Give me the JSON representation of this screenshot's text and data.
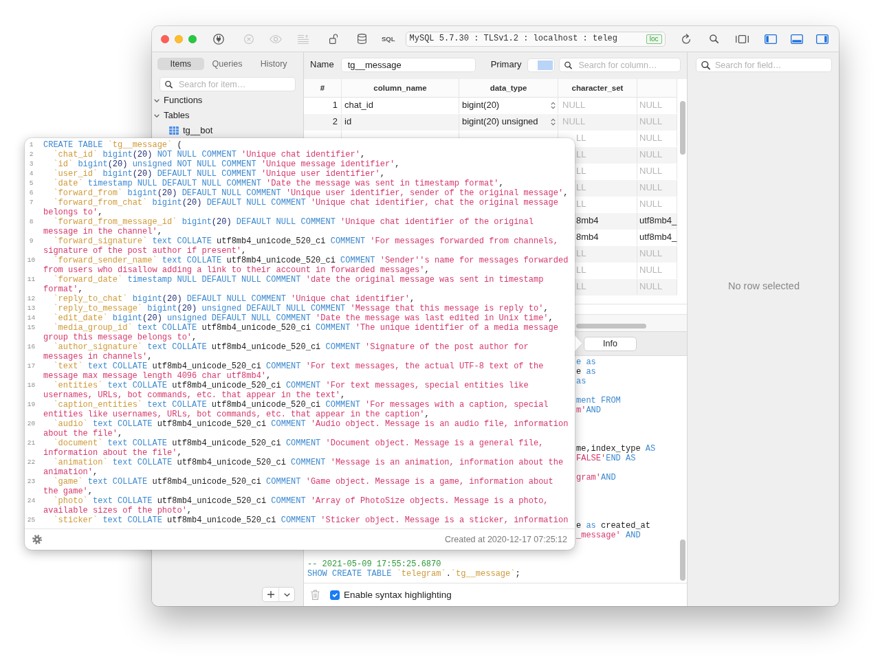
{
  "toolbar": {
    "buttons": [
      {
        "disabled": false
      },
      {
        "disabled": true
      },
      {
        "disabled": true
      },
      {
        "disabled": true
      },
      {
        "disabled": false
      },
      {
        "disabled": false
      }
    ],
    "sql_button": "SQL",
    "connection": "MySQL 5.7.30 : TLSv1.2 : localhost : teleg",
    "connection_tag": "loc",
    "panel_toggles": [
      {
        "on": true
      },
      {
        "on": true
      },
      {
        "on": true
      }
    ]
  },
  "sidebar": {
    "tabs": [
      {
        "label": "Items",
        "selected": true
      },
      {
        "label": "Queries",
        "selected": false
      },
      {
        "label": "History",
        "selected": false
      }
    ],
    "search": {
      "placeholder": "Search for item…"
    },
    "tree": [
      {
        "label": "Functions",
        "expanded": true
      },
      {
        "label": "Tables",
        "expanded": true,
        "children": [
          {
            "label": "tg__bot"
          }
        ]
      }
    ]
  },
  "structure": {
    "name_label": "Name",
    "name": "tg__message",
    "primary_label": "Primary",
    "column_search": {
      "placeholder": "Search for column…"
    },
    "table": {
      "columns": [
        "#",
        "column_name",
        "data_type",
        "character_set"
      ],
      "rows": [
        {
          "number": "1",
          "column_name": "chat_id",
          "data_type": "bigint(20)",
          "character_set": {
            "text": "NULL",
            "null": true
          },
          "column_5": {
            "text": "NULL",
            "null": true
          }
        },
        {
          "number": "2",
          "column_name": "id",
          "data_type": "bigint(20) unsigned",
          "character_set": {
            "text": "NULL",
            "null": true
          },
          "column_5": {
            "text": "NULL",
            "null": true
          }
        },
        {
          "character_set": {
            "text": "LL",
            "null": true
          },
          "column_5": {
            "text": "NULL",
            "null": true
          }
        },
        {
          "character_set": {
            "text": "LL",
            "null": true
          },
          "column_5": {
            "text": "NULL",
            "null": true
          }
        },
        {
          "character_set": {
            "text": "LL",
            "null": true
          },
          "column_5": {
            "text": "NULL",
            "null": true
          }
        },
        {
          "character_set": {
            "text": "LL",
            "null": true
          },
          "column_5": {
            "text": "NULL",
            "null": true
          }
        },
        {
          "character_set": {
            "text": "LL",
            "null": true
          },
          "column_5": {
            "text": "NULL",
            "null": true
          }
        },
        {
          "character_set": {
            "text": "8mb4",
            "null": false
          },
          "column_5": {
            "text": "utf8mb4_",
            "null": false
          }
        },
        {
          "character_set": {
            "text": "8mb4",
            "null": false
          },
          "column_5": {
            "text": "utf8mb4_",
            "null": false
          }
        },
        {
          "character_set": {
            "text": "LL",
            "null": true
          },
          "column_5": {
            "text": "NULL",
            "null": true
          }
        },
        {
          "character_set": {
            "text": "LL",
            "null": true
          },
          "column_5": {
            "text": "NULL",
            "null": true
          }
        },
        {
          "character_set": {
            "text": "LL",
            "null": true
          },
          "column_5": {
            "text": "NULL",
            "null": true
          }
        }
      ]
    },
    "tabs": [
      {
        "label": "Info",
        "selected": true
      }
    ],
    "console": {
      "covered_lines": [
        {
          "tokens": [
            {
              "kind": "keyword",
              "text": "e as"
            }
          ]
        },
        {
          "tokens": [
            {
              "kind": "plain",
              "text": "e"
            },
            {
              "kind": "keyword",
              "text": " as"
            }
          ]
        },
        {
          "tokens": [
            {
              "kind": "keyword",
              "text": "as"
            }
          ]
        },
        {
          "tokens": [
            {
              "kind": "keyword",
              "text": "ment FROM"
            }
          ]
        },
        {
          "tokens": [
            {
              "kind": "string",
              "text": "m'"
            },
            {
              "kind": "keyword",
              "text": "AND"
            }
          ]
        },
        {
          "tokens": [
            {
              "kind": "plain",
              "text": "me,index_type"
            },
            {
              "kind": "keyword",
              "text": " AS"
            }
          ]
        },
        {
          "tokens": [
            {
              "kind": "string",
              "text": "FALSE'"
            },
            {
              "kind": "keyword",
              "text": "END AS"
            }
          ]
        },
        {
          "tokens": [
            {
              "kind": "string",
              "text": "gram'"
            },
            {
              "kind": "keyword",
              "text": "AND"
            }
          ]
        },
        {
          "tokens": [
            {
              "kind": "plain",
              "text": "e "
            },
            {
              "kind": "keyword",
              "text": "as"
            },
            {
              "kind": "plain",
              "text": " created_at"
            }
          ]
        },
        {
          "tokens": [
            {
              "kind": "string",
              "text": "_message'"
            },
            {
              "kind": "keyword",
              "text": " AND"
            }
          ]
        }
      ],
      "lines": [
        {
          "tokens": [
            {
              "kind": "comment",
              "text": "-- 2021-05-09 17:55:25.6870"
            }
          ]
        },
        {
          "tokens": [
            {
              "kind": "keyword",
              "text": "SHOW CREATE TABLE "
            },
            {
              "kind": "identifier",
              "text": "`telegram`"
            },
            {
              "kind": "plain",
              "text": "."
            },
            {
              "kind": "identifier",
              "text": "`tg__message`"
            },
            {
              "kind": "plain",
              "text": ";"
            }
          ]
        }
      ]
    },
    "syntax_highlighting": {
      "label": "Enable syntax highlighting",
      "checked": true
    }
  },
  "details": {
    "search": {
      "placeholder": "Search for field…"
    },
    "empty_message": "No row selected"
  },
  "create_table_popover": {
    "lines": [
      {
        "number": "1",
        "tokens": [
          {
            "kind": "keyword",
            "text": "CREATE TABLE "
          },
          {
            "kind": "identifier",
            "text": "`tg__message`"
          },
          {
            "kind": "plain",
            "text": " ("
          }
        ]
      },
      {
        "number": "2",
        "tokens": [
          {
            "kind": "identifier",
            "text": "  `chat_id`"
          },
          {
            "kind": "keyword",
            "text": " bigint"
          },
          {
            "kind": "number",
            "text": "(20)"
          },
          {
            "kind": "keyword",
            "text": " NOT NULL COMMENT "
          },
          {
            "kind": "string",
            "text": "'Unique chat identifier'"
          },
          {
            "kind": "plain",
            "text": ","
          }
        ]
      },
      {
        "number": "3",
        "tokens": [
          {
            "kind": "identifier",
            "text": "  `id`"
          },
          {
            "kind": "keyword",
            "text": " bigint"
          },
          {
            "kind": "number",
            "text": "(20)"
          },
          {
            "kind": "keyword",
            "text": " unsigned NOT NULL COMMENT "
          },
          {
            "kind": "string",
            "text": "'Unique message identifier'"
          },
          {
            "kind": "plain",
            "text": ","
          }
        ]
      },
      {
        "number": "4",
        "tokens": [
          {
            "kind": "identifier",
            "text": "  `user_id`"
          },
          {
            "kind": "keyword",
            "text": " bigint"
          },
          {
            "kind": "number",
            "text": "(20)"
          },
          {
            "kind": "keyword",
            "text": " DEFAULT NULL COMMENT "
          },
          {
            "kind": "string",
            "text": "'Unique user identifier'"
          },
          {
            "kind": "plain",
            "text": ","
          }
        ]
      },
      {
        "number": "5",
        "tokens": [
          {
            "kind": "identifier",
            "text": "  `date`"
          },
          {
            "kind": "keyword",
            "text": " timestamp NULL DEFAULT NULL COMMENT "
          },
          {
            "kind": "string",
            "text": "'Date the message was sent in timestamp format'"
          },
          {
            "kind": "plain",
            "text": ","
          }
        ]
      },
      {
        "number": "6",
        "tokens": [
          {
            "kind": "identifier",
            "text": "  `forward_from`"
          },
          {
            "kind": "keyword",
            "text": " bigint"
          },
          {
            "kind": "number",
            "text": "(20)"
          },
          {
            "kind": "keyword",
            "text": " DEFAULT NULL COMMENT "
          },
          {
            "kind": "string",
            "text": "'Unique user identifier, sender of the original message'"
          },
          {
            "kind": "plain",
            "text": ","
          }
        ]
      },
      {
        "number": "7",
        "tokens": [
          {
            "kind": "identifier",
            "text": "  `forward_from_chat`"
          },
          {
            "kind": "keyword",
            "text": " bigint"
          },
          {
            "kind": "number",
            "text": "(20)"
          },
          {
            "kind": "keyword",
            "text": " DEFAULT NULL COMMENT "
          },
          {
            "kind": "string",
            "text": "'Unique chat identifier, chat the original message belongs to'"
          },
          {
            "kind": "plain",
            "text": ","
          }
        ]
      },
      {
        "number": "8",
        "tokens": [
          {
            "kind": "identifier",
            "text": "  `forward_from_message_id`"
          },
          {
            "kind": "keyword",
            "text": " bigint"
          },
          {
            "kind": "number",
            "text": "(20)"
          },
          {
            "kind": "keyword",
            "text": " DEFAULT NULL COMMENT "
          },
          {
            "kind": "string",
            "text": "'Unique chat identifier of the original message in the channel'"
          },
          {
            "kind": "plain",
            "text": ","
          }
        ]
      },
      {
        "number": "9",
        "tokens": [
          {
            "kind": "identifier",
            "text": "  `forward_signature`"
          },
          {
            "kind": "keyword",
            "text": " text COLLATE "
          },
          {
            "kind": "plain",
            "text": "utf8mb4_unicode_520_ci"
          },
          {
            "kind": "keyword",
            "text": " COMMENT "
          },
          {
            "kind": "string",
            "text": "'For messages forwarded from channels, signature of the post author if present'"
          },
          {
            "kind": "plain",
            "text": ","
          }
        ]
      },
      {
        "number": "10",
        "tokens": [
          {
            "kind": "identifier",
            "text": "  `forward_sender_name`"
          },
          {
            "kind": "keyword",
            "text": " text COLLATE "
          },
          {
            "kind": "plain",
            "text": "utf8mb4_unicode_520_ci"
          },
          {
            "kind": "keyword",
            "text": " COMMENT "
          },
          {
            "kind": "string",
            "text": "'Sender''s name for messages forwarded from users who disallow adding a link to their account in forwarded messages'"
          },
          {
            "kind": "plain",
            "text": ","
          }
        ]
      },
      {
        "number": "11",
        "tokens": [
          {
            "kind": "identifier",
            "text": "  `forward_date`"
          },
          {
            "kind": "keyword",
            "text": " timestamp NULL DEFAULT NULL COMMENT "
          },
          {
            "kind": "string",
            "text": "'date the original message was sent in timestamp format'"
          },
          {
            "kind": "plain",
            "text": ","
          }
        ]
      },
      {
        "number": "12",
        "tokens": [
          {
            "kind": "identifier",
            "text": "  `reply_to_chat`"
          },
          {
            "kind": "keyword",
            "text": " bigint"
          },
          {
            "kind": "number",
            "text": "(20)"
          },
          {
            "kind": "keyword",
            "text": " DEFAULT NULL COMMENT "
          },
          {
            "kind": "string",
            "text": "'Unique chat identifier'"
          },
          {
            "kind": "plain",
            "text": ","
          }
        ]
      },
      {
        "number": "13",
        "tokens": [
          {
            "kind": "identifier",
            "text": "  `reply_to_message`"
          },
          {
            "kind": "keyword",
            "text": " bigint"
          },
          {
            "kind": "number",
            "text": "(20)"
          },
          {
            "kind": "keyword",
            "text": " unsigned DEFAULT NULL COMMENT "
          },
          {
            "kind": "string",
            "text": "'Message that this message is reply to'"
          },
          {
            "kind": "plain",
            "text": ","
          }
        ]
      },
      {
        "number": "14",
        "tokens": [
          {
            "kind": "identifier",
            "text": "  `edit_date`"
          },
          {
            "kind": "keyword",
            "text": " bigint"
          },
          {
            "kind": "number",
            "text": "(20)"
          },
          {
            "kind": "keyword",
            "text": " unsigned DEFAULT NULL COMMENT "
          },
          {
            "kind": "string",
            "text": "'Date the message was last edited in Unix time'"
          },
          {
            "kind": "plain",
            "text": ","
          }
        ]
      },
      {
        "number": "15",
        "tokens": [
          {
            "kind": "identifier",
            "text": "  `media_group_id`"
          },
          {
            "kind": "keyword",
            "text": " text COLLATE "
          },
          {
            "kind": "plain",
            "text": "utf8mb4_unicode_520_ci"
          },
          {
            "kind": "keyword",
            "text": " COMMENT "
          },
          {
            "kind": "string",
            "text": "'The unique identifier of a media message group this message belongs to'"
          },
          {
            "kind": "plain",
            "text": ","
          }
        ]
      },
      {
        "number": "16",
        "tokens": [
          {
            "kind": "identifier",
            "text": "  `author_signature`"
          },
          {
            "kind": "keyword",
            "text": " text COLLATE "
          },
          {
            "kind": "plain",
            "text": "utf8mb4_unicode_520_ci"
          },
          {
            "kind": "keyword",
            "text": " COMMENT "
          },
          {
            "kind": "string",
            "text": "'Signature of the post author for messages in channels'"
          },
          {
            "kind": "plain",
            "text": ","
          }
        ]
      },
      {
        "number": "17",
        "tokens": [
          {
            "kind": "identifier",
            "text": "  `text`"
          },
          {
            "kind": "keyword",
            "text": " text COLLATE "
          },
          {
            "kind": "plain",
            "text": "utf8mb4_unicode_520_ci"
          },
          {
            "kind": "keyword",
            "text": " COMMENT "
          },
          {
            "kind": "string",
            "text": "'For text messages, the actual UTF-8 text of the message max message length 4096 char utf8mb4'"
          },
          {
            "kind": "plain",
            "text": ","
          }
        ]
      },
      {
        "number": "18",
        "tokens": [
          {
            "kind": "identifier",
            "text": "  `entities`"
          },
          {
            "kind": "keyword",
            "text": " text COLLATE "
          },
          {
            "kind": "plain",
            "text": "utf8mb4_unicode_520_ci"
          },
          {
            "kind": "keyword",
            "text": " COMMENT "
          },
          {
            "kind": "string",
            "text": "'For text messages, special entities like usernames, URLs, bot commands, etc. that appear in the text'"
          },
          {
            "kind": "plain",
            "text": ","
          }
        ]
      },
      {
        "number": "19",
        "tokens": [
          {
            "kind": "identifier",
            "text": "  `caption_entities`"
          },
          {
            "kind": "keyword",
            "text": " text COLLATE "
          },
          {
            "kind": "plain",
            "text": "utf8mb4_unicode_520_ci"
          },
          {
            "kind": "keyword",
            "text": " COMMENT "
          },
          {
            "kind": "string",
            "text": "'For messages with a caption, special entities like usernames, URLs, bot commands, etc. that appear in the caption'"
          },
          {
            "kind": "plain",
            "text": ","
          }
        ]
      },
      {
        "number": "20",
        "tokens": [
          {
            "kind": "identifier",
            "text": "  `audio`"
          },
          {
            "kind": "keyword",
            "text": " text COLLATE "
          },
          {
            "kind": "plain",
            "text": "utf8mb4_unicode_520_ci"
          },
          {
            "kind": "keyword",
            "text": " COMMENT "
          },
          {
            "kind": "string",
            "text": "'Audio object. Message is an audio file, information about the file'"
          },
          {
            "kind": "plain",
            "text": ","
          }
        ]
      },
      {
        "number": "21",
        "tokens": [
          {
            "kind": "identifier",
            "text": "  `document`"
          },
          {
            "kind": "keyword",
            "text": " text COLLATE "
          },
          {
            "kind": "plain",
            "text": "utf8mb4_unicode_520_ci"
          },
          {
            "kind": "keyword",
            "text": " COMMENT "
          },
          {
            "kind": "string",
            "text": "'Document object. Message is a general file, information about the file'"
          },
          {
            "kind": "plain",
            "text": ","
          }
        ]
      },
      {
        "number": "22",
        "tokens": [
          {
            "kind": "identifier",
            "text": "  `animation`"
          },
          {
            "kind": "keyword",
            "text": " text COLLATE "
          },
          {
            "kind": "plain",
            "text": "utf8mb4_unicode_520_ci"
          },
          {
            "kind": "keyword",
            "text": " COMMENT "
          },
          {
            "kind": "string",
            "text": "'Message is an animation, information about the animation'"
          },
          {
            "kind": "plain",
            "text": ","
          }
        ]
      },
      {
        "number": "23",
        "tokens": [
          {
            "kind": "identifier",
            "text": "  `game`"
          },
          {
            "kind": "keyword",
            "text": " text COLLATE "
          },
          {
            "kind": "plain",
            "text": "utf8mb4_unicode_520_ci"
          },
          {
            "kind": "keyword",
            "text": " COMMENT "
          },
          {
            "kind": "string",
            "text": "'Game object. Message is a game, information about the game'"
          },
          {
            "kind": "plain",
            "text": ","
          }
        ]
      },
      {
        "number": "24",
        "tokens": [
          {
            "kind": "identifier",
            "text": "  `photo`"
          },
          {
            "kind": "keyword",
            "text": " text COLLATE "
          },
          {
            "kind": "plain",
            "text": "utf8mb4_unicode_520_ci"
          },
          {
            "kind": "keyword",
            "text": " COMMENT "
          },
          {
            "kind": "string",
            "text": "'Array of PhotoSize objects. Message is a photo, available sizes of the photo'"
          },
          {
            "kind": "plain",
            "text": ","
          }
        ]
      },
      {
        "number": "25",
        "tokens": [
          {
            "kind": "identifier",
            "text": "  `sticker`"
          },
          {
            "kind": "keyword",
            "text": " text COLLATE "
          },
          {
            "kind": "plain",
            "text": "utf8mb4_unicode_520_ci"
          },
          {
            "kind": "keyword",
            "text": " COMMENT "
          },
          {
            "kind": "string",
            "text": "'Sticker object. Message is a sticker, information"
          }
        ]
      }
    ],
    "created_at": "Created at 2020-12-17 07:25:12"
  }
}
